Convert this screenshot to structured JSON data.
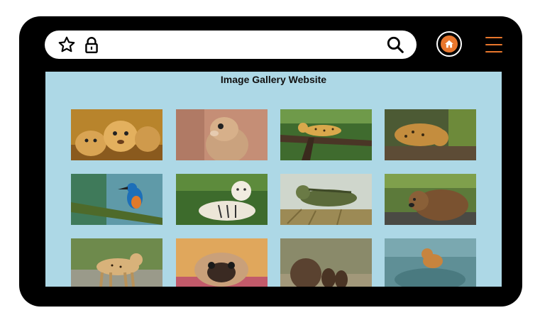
{
  "browser": {
    "toolbar_icons": [
      "star-icon",
      "lock-icon",
      "search-icon",
      "home-icon",
      "hamburger-menu-icon"
    ],
    "accent_color": "#e8762c"
  },
  "page": {
    "title": "Image Gallery Website",
    "background_color": "#add8e6"
  },
  "gallery": {
    "images": [
      {
        "subject": "lion-cubs"
      },
      {
        "subject": "squirrel"
      },
      {
        "subject": "leopard-on-branch"
      },
      {
        "subject": "jaguar"
      },
      {
        "subject": "kingfisher"
      },
      {
        "subject": "white-tiger"
      },
      {
        "subject": "iguana"
      },
      {
        "subject": "brown-bear"
      },
      {
        "subject": "cheetah"
      },
      {
        "subject": "pug"
      },
      {
        "subject": "bear-family"
      },
      {
        "subject": "lynx"
      }
    ]
  }
}
